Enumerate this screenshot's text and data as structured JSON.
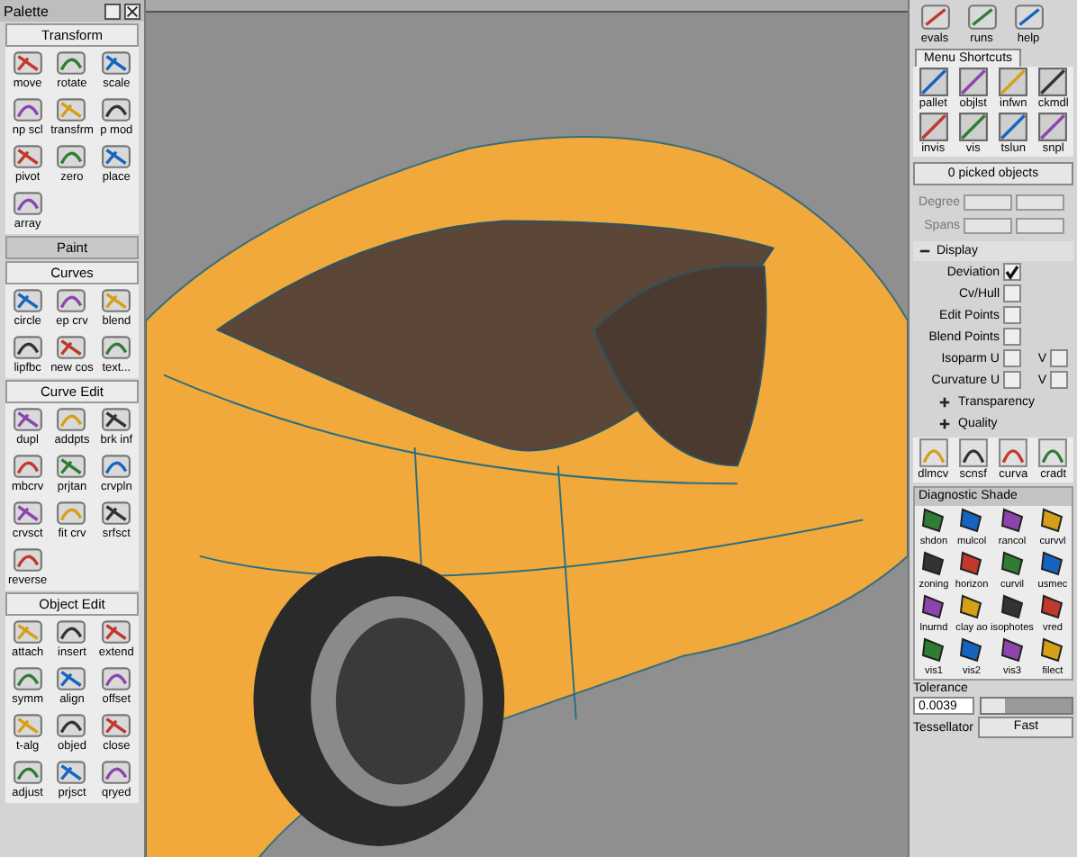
{
  "palette": {
    "title": "Palette",
    "sections": [
      {
        "title": "Transform",
        "expanded": true,
        "tools": [
          "move",
          "rotate",
          "scale",
          "np scl",
          "transfrm",
          "p mod",
          "pivot",
          "zero",
          "place",
          "array"
        ]
      },
      {
        "title": "Paint",
        "expanded": false
      },
      {
        "title": "Curves",
        "expanded": true,
        "tools": [
          "circle",
          "ep crv",
          "blend",
          "lipfbc",
          "new cos",
          "text..."
        ]
      },
      {
        "title": "Curve Edit",
        "expanded": true,
        "tools": [
          "dupl",
          "addpts",
          "brk inf",
          "mbcrv",
          "prjtan",
          "crvpln",
          "crvsct",
          "fit crv",
          "srfsct",
          "reverse"
        ]
      },
      {
        "title": "Object Edit",
        "expanded": true,
        "tools": [
          "attach",
          "insert",
          "extend",
          "symm",
          "align",
          "offset",
          "t-alg",
          "objed",
          "close",
          "adjust",
          "prjsct",
          "qryed"
        ]
      }
    ]
  },
  "right_panel": {
    "top_tools": [
      "evals",
      "runs",
      "help"
    ],
    "tab": "Menu Shortcuts",
    "shortcuts": [
      "pallet",
      "objlst",
      "infwn",
      "ckmdl",
      "invis",
      "vis",
      "tslun",
      "snpl"
    ],
    "picked": "0 picked objects",
    "fields": [
      {
        "label": "Degree"
      },
      {
        "label": "Spans"
      }
    ],
    "display": {
      "title": "Display",
      "expanded": true,
      "options": [
        {
          "label": "Deviation",
          "checked": true
        },
        {
          "label": "Cv/Hull",
          "checked": false
        },
        {
          "label": "Edit Points",
          "checked": false
        },
        {
          "label": "Blend Points",
          "checked": false
        },
        {
          "label": "Isoparm U",
          "checked": false,
          "extra": {
            "label": "V",
            "checked": false
          }
        },
        {
          "label": "Curvature U",
          "checked": false,
          "extra": {
            "label": "V",
            "checked": false
          }
        }
      ],
      "subsections": [
        {
          "title": "Transparency",
          "expanded": false
        },
        {
          "title": "Quality",
          "expanded": false
        }
      ]
    },
    "shelf": [
      "dlmcv",
      "scnsf",
      "curva",
      "cradt"
    ],
    "diagnostic": {
      "title": "Diagnostic Shade",
      "tools": [
        "shdon",
        "mulcol",
        "rancol",
        "curvvl",
        "zoning",
        "horizon",
        "curvil",
        "usmec",
        "lnurnd",
        "clay ao",
        "isophotes",
        "vred",
        "vis1",
        "vis2",
        "vis3",
        "filect"
      ],
      "tolerance_label": "Tolerance",
      "tolerance": "0.0039",
      "tolerance_slider": {
        "level": 0.25
      },
      "tessellator_label": "Tessellator",
      "tessellator": "Fast"
    }
  }
}
